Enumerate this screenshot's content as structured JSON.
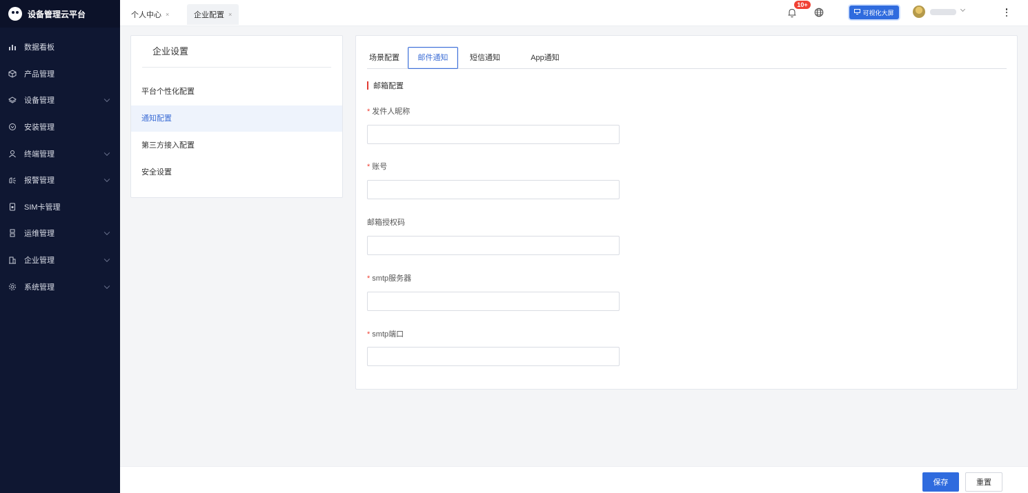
{
  "app": {
    "title": "设备管理云平台"
  },
  "sidebar": {
    "items": [
      {
        "label": "数据看板",
        "icon": "chart-icon",
        "expandable": false
      },
      {
        "label": "产品管理",
        "icon": "cube-icon",
        "expandable": false
      },
      {
        "label": "设备管理",
        "icon": "layers-icon",
        "expandable": true
      },
      {
        "label": "安装管理",
        "icon": "install-icon",
        "expandable": false
      },
      {
        "label": "终端管理",
        "icon": "user-icon",
        "expandable": true
      },
      {
        "label": "报警管理",
        "icon": "alarm-icon",
        "expandable": true
      },
      {
        "label": "SIM卡管理",
        "icon": "sim-icon",
        "expandable": false
      },
      {
        "label": "运维管理",
        "icon": "ops-icon",
        "expandable": true
      },
      {
        "label": "企业管理",
        "icon": "building-icon",
        "expandable": true
      },
      {
        "label": "系统管理",
        "icon": "gear-icon",
        "expandable": true
      }
    ]
  },
  "topbar": {
    "tabs": [
      {
        "label": "个人中心",
        "close": "×",
        "active": false
      },
      {
        "label": "企业配置",
        "close": "×",
        "active": true
      }
    ],
    "notification_badge": "10+",
    "bigscreen_label": "可视化大屏"
  },
  "settings": {
    "title": "企业设置",
    "items": [
      {
        "label": "平台个性化配置",
        "active": false
      },
      {
        "label": "通知配置",
        "active": true
      },
      {
        "label": "第三方接入配置",
        "active": false
      },
      {
        "label": "安全设置",
        "active": false
      }
    ]
  },
  "notify": {
    "tabs": [
      {
        "label": "场景配置",
        "active": false
      },
      {
        "label": "邮件通知",
        "active": true
      },
      {
        "label": "短信通知",
        "active": false
      },
      {
        "label": "App通知",
        "active": false
      }
    ],
    "section_title": "邮箱配置",
    "required_mark": "*",
    "fields": [
      {
        "label": "发件人昵称",
        "required": true,
        "value": ""
      },
      {
        "label": "账号",
        "required": true,
        "value": ""
      },
      {
        "label": "邮箱授权码",
        "required": false,
        "value": ""
      },
      {
        "label": "smtp服务器",
        "required": true,
        "value": ""
      },
      {
        "label": "smtp端口",
        "required": true,
        "value": ""
      }
    ]
  },
  "footer": {
    "save_label": "保存",
    "reset_label": "重置"
  },
  "colors": {
    "sidebar_bg": "#0f1732",
    "primary": "#2f6bde",
    "required": "#f04134",
    "badge": "#f04134"
  }
}
